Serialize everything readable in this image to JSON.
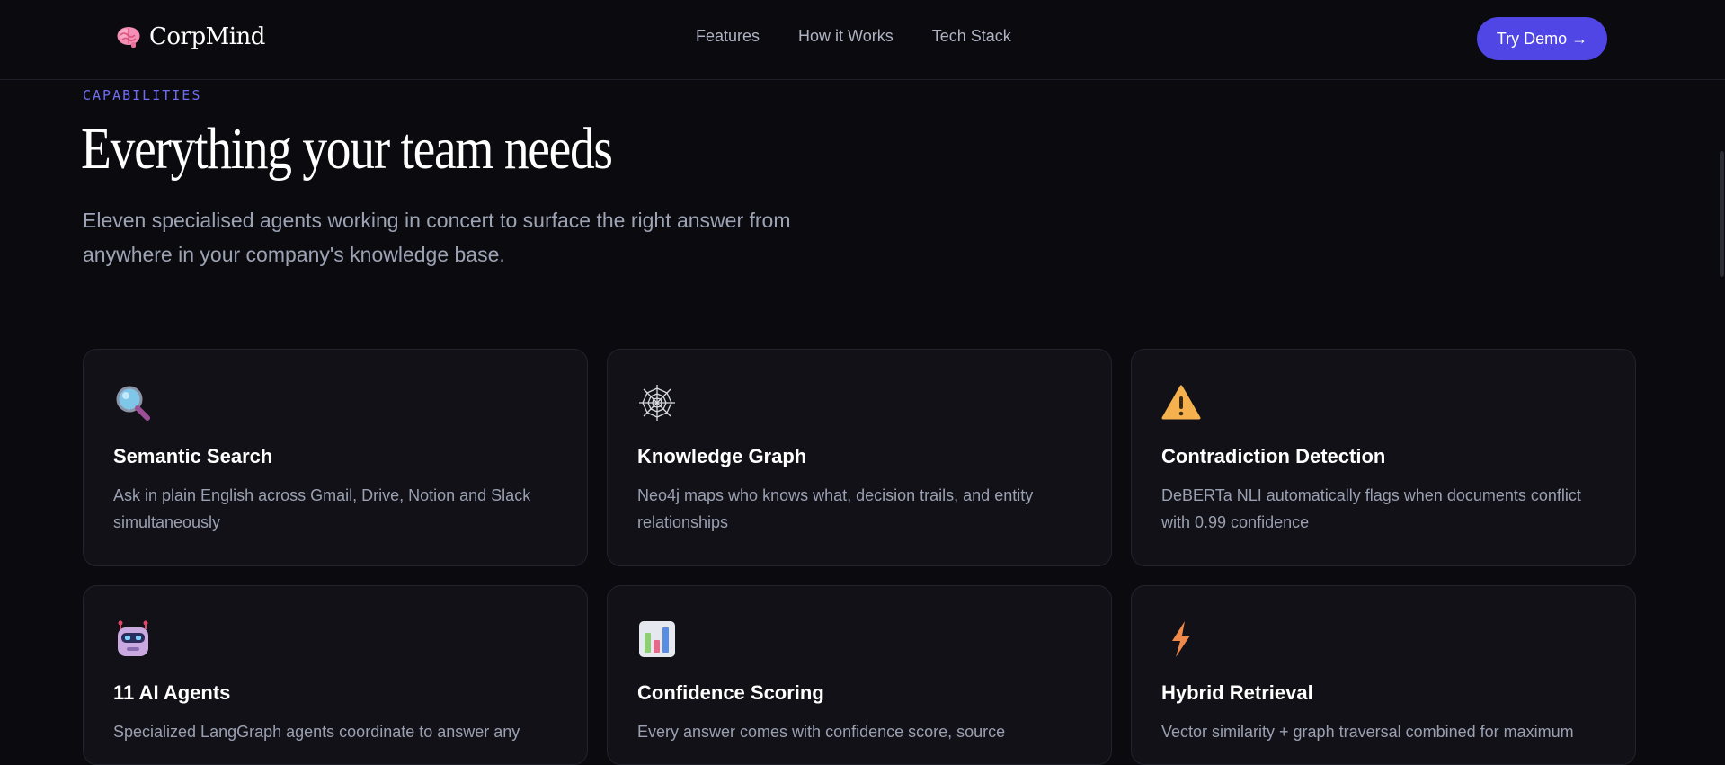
{
  "nav": {
    "brand": "CorpMind",
    "brand_icon": "brain-icon",
    "links": [
      "Features",
      "How it Works",
      "Tech Stack"
    ],
    "cta_label": "Try Demo →"
  },
  "hero": {
    "eyebrow": "CAPABILITIES",
    "title": "Everything your team needs",
    "subtitle": "Eleven specialised agents working in concert to surface the right answer from anywhere in your company's knowledge base."
  },
  "colors": {
    "background": "#0b0b0f",
    "accent": "#4f46e5",
    "eyebrow": "#6f6cf0",
    "card_bg": "#111117"
  },
  "cards": [
    {
      "icon": "magnifier-icon",
      "title": "Semantic Search",
      "desc": "Ask in plain English across Gmail, Drive, Notion and Slack simultaneously"
    },
    {
      "icon": "spider-web-icon",
      "title": "Knowledge Graph",
      "desc": "Neo4j maps who knows what, decision trails, and entity relationships"
    },
    {
      "icon": "warning-icon",
      "title": "Contradiction Detection",
      "desc": "DeBERTa NLI automatically flags when documents conflict with 0.99 confidence"
    },
    {
      "icon": "robot-icon",
      "title": "11 AI Agents",
      "desc": "Specialized LangGraph agents coordinate to answer any"
    },
    {
      "icon": "bar-chart-icon",
      "title": "Confidence Scoring",
      "desc": "Every answer comes with confidence score, source"
    },
    {
      "icon": "lightning-icon",
      "title": "Hybrid Retrieval",
      "desc": "Vector similarity + graph traversal combined for maximum"
    }
  ]
}
